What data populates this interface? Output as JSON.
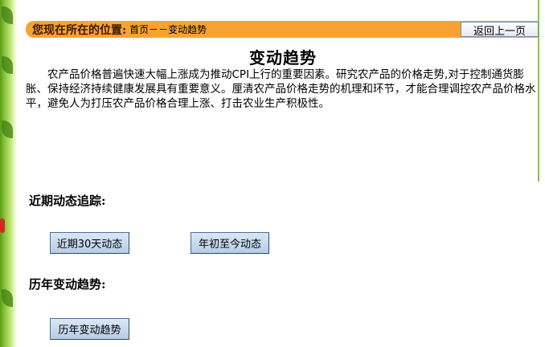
{
  "location": {
    "label": "您现在所在的位置:",
    "path": "首页－－变动趋势",
    "back_label": "返回上一页"
  },
  "title": "变动趋势",
  "intro": "农产品价格普遍快速大幅上涨成为推动CPI上行的重要因素。研究农产品的价格走势,对于控制通货膨胀、保持经济持续健康发展具有重要意义。厘清农产品价格走势的机理和环节，才能合理调控农产品价格水平，避免人为打压农产品价格合理上涨、打击农业生产积极性。",
  "sections": {
    "recent": {
      "heading": "近期动态追踪:",
      "buttons": [
        "近期30天动态",
        "年初至今动态"
      ]
    },
    "history": {
      "heading": "历年变动趋势:",
      "buttons": [
        "历年变动趋势"
      ]
    }
  },
  "colors": {
    "location_bar": "#f7a332",
    "left_border": "#8cc63e",
    "button_fill": "#b5cce6"
  }
}
